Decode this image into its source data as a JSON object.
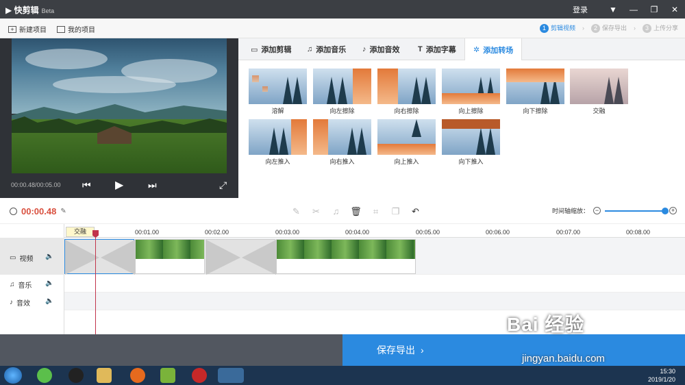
{
  "app": {
    "title": "快剪辑",
    "beta": "Beta",
    "login": "登录"
  },
  "toolbar": {
    "new_project": "新建项目",
    "my_projects": "我的项目"
  },
  "steps": [
    {
      "num": "1",
      "label": "剪辑视频"
    },
    {
      "num": "2",
      "label": "保存导出"
    },
    {
      "num": "3",
      "label": "上传分享"
    }
  ],
  "preview": {
    "time": "00:00.48/00:05.00"
  },
  "tabs": [
    "添加剪辑",
    "添加音乐",
    "添加音效",
    "添加字幕",
    "添加转场"
  ],
  "transitions": [
    "溶解",
    "向左擦除",
    "向右擦除",
    "向上擦除",
    "向下擦除",
    "交融",
    "向左推入",
    "向右推入",
    "向上推入",
    "向下推入"
  ],
  "timeline": {
    "current_time": "00:00.48",
    "zoom_label": "时间轴缩放：",
    "zoom_level": 0.9,
    "ruler": [
      "00:01.00",
      "00:02.00",
      "00:03.00",
      "00:04.00",
      "00:05.00",
      "00:06.00",
      "00:07.00",
      "00:08.00"
    ],
    "tracks": [
      "视频",
      "音乐",
      "音效"
    ],
    "tooltip": "交融"
  },
  "save_button": "保存导出",
  "taskbar": {
    "time": "15:30",
    "date": "2019/1/20"
  },
  "watermark": {
    "brand": "Bai 经验",
    "url": "jingyan.baidu.com"
  },
  "colors": {
    "accent": "#2b8ae0",
    "playhead": "#c1334a",
    "time": "#d9503f"
  }
}
